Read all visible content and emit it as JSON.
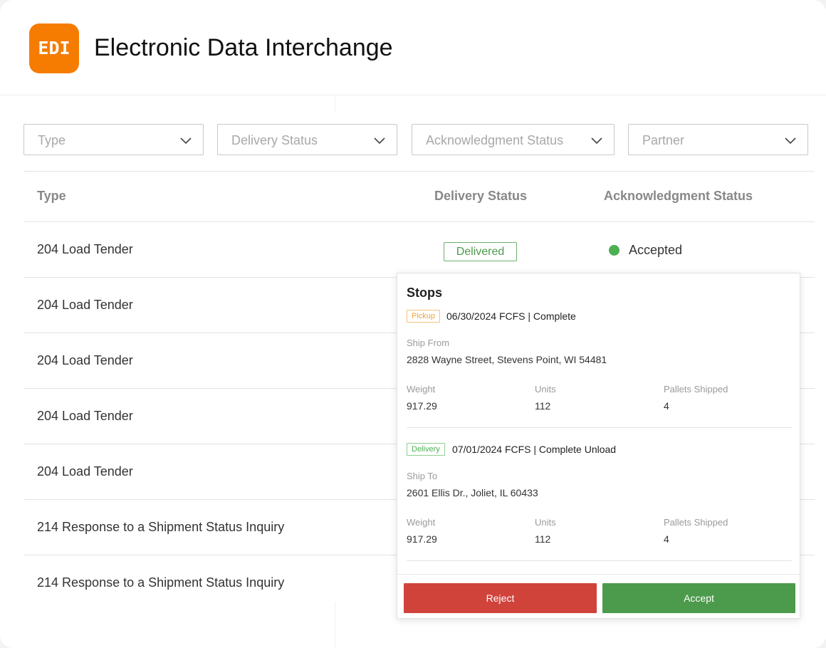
{
  "app": {
    "logo_text": "EDI",
    "title": "Electronic Data Interchange",
    "logo_color": "#f57c00"
  },
  "filters": [
    {
      "placeholder": "Type",
      "icon": "chevron-down-icon"
    },
    {
      "placeholder": "Delivery Status",
      "icon": "chevron-down-icon"
    },
    {
      "placeholder": "Acknowledgment Status",
      "icon": "chevron-down-icon"
    },
    {
      "placeholder": "Partner",
      "icon": "chevron-down-icon"
    }
  ],
  "table": {
    "headers": {
      "type": "Type",
      "delivery": "Delivery Status",
      "ack": "Acknowledgment Status"
    },
    "rows": [
      {
        "type": "204 Load Tender",
        "delivery": "Delivered",
        "ack": "Accepted",
        "ack_color": "#4caf50"
      },
      {
        "type": "204 Load Tender"
      },
      {
        "type": "204 Load Tender"
      },
      {
        "type": "204 Load Tender"
      },
      {
        "type": "204 Load Tender"
      },
      {
        "type": "214 Response to a Shipment Status Inquiry"
      },
      {
        "type": "214 Response to a Shipment Status Inquiry"
      }
    ]
  },
  "popup": {
    "title": "Stops",
    "stops": [
      {
        "tag": "Pickup",
        "date_text": "06/30/2024 FCFS | Complete",
        "address_label": "Ship From",
        "address": "2828 Wayne Street, Stevens Point, WI 54481",
        "weight_label": "Weight",
        "weight": "917.29",
        "units_label": "Units",
        "units": "112",
        "pallets_label": "Pallets Shipped",
        "pallets": "4"
      },
      {
        "tag": "Delivery",
        "date_text": "07/01/2024 FCFS | Complete Unload",
        "address_label": "Ship To",
        "address": "2601 Ellis Dr., Joliet, IL 60433",
        "weight_label": "Weight",
        "weight": "917.29",
        "units_label": "Units",
        "units": "112",
        "pallets_label": "Pallets Shipped",
        "pallets": "4"
      }
    ],
    "reject_label": "Reject",
    "accept_label": "Accept",
    "reject_color": "#d0433b",
    "accept_color": "#4c9a4c"
  }
}
